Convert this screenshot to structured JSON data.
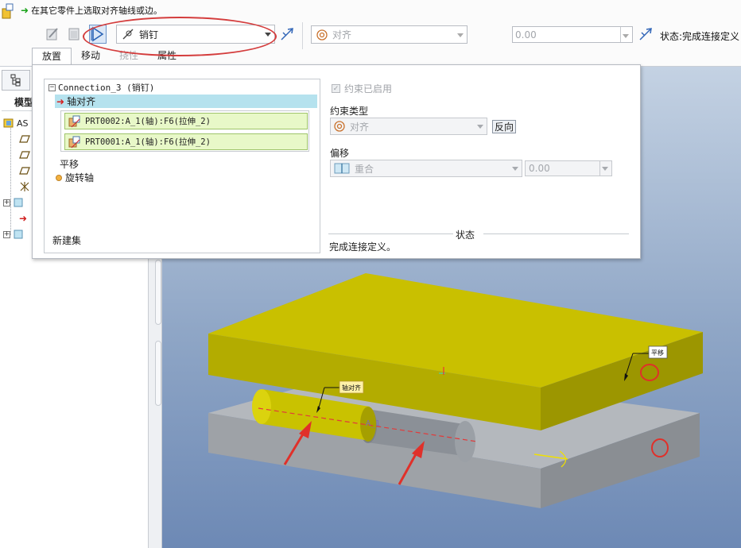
{
  "message": "在其它零件上选取对齐轴线或边。",
  "dashboard": {
    "connection_type": "销钉",
    "constraint_type": "对齐",
    "offset_value": "0.00",
    "status_label": "状态:完成连接定义"
  },
  "tabs": [
    {
      "label": "放置",
      "state": "active"
    },
    {
      "label": "移动",
      "state": "normal"
    },
    {
      "label": "挠性",
      "state": "disabled"
    },
    {
      "label": "属性",
      "state": "normal"
    }
  ],
  "tree": {
    "title": "模型",
    "root_label": "AS",
    "items": [
      "",
      "",
      "",
      "",
      "",
      "",
      ""
    ]
  },
  "placement": {
    "connection_name": "Connection_3 (销钉)",
    "active_constraint": "轴对齐",
    "references": [
      "PRT0002:A_1(轴):F6(拉伸_2)",
      "PRT0001:A_1(轴):F6(拉伸_2)"
    ],
    "translation_label": "平移",
    "rotation_axis_label": "旋转轴",
    "new_set_label": "新建集",
    "constraint_enabled_label": "约束已启用",
    "constraint_type_label": "约束类型",
    "constraint_type_value": "对齐",
    "flip_label": "反向",
    "offset_label": "偏移",
    "offset_type_value": "重合",
    "offset_value": "0.00",
    "status_legend": "状态",
    "status_message": "完成连接定义。"
  },
  "viewport": {
    "callout_axis_align": "轴对齐",
    "callout_translation": "平移",
    "axis_label": "A_1",
    "colors": {
      "top_plate": "#bdb500",
      "bottom_plate": "#a2a6ab",
      "pin": "#cfc400",
      "pin_grey": "#8a9096",
      "annotation_red": "#e0302a"
    }
  }
}
